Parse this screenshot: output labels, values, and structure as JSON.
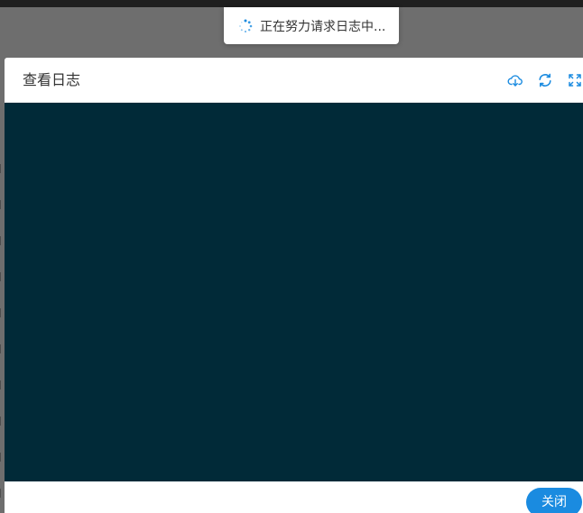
{
  "toast": {
    "spinner_icon": "loading-spinner-icon",
    "message": "正在努力请求日志中..."
  },
  "modal": {
    "title": "查看日志",
    "header_icons": [
      "cloud-download-icon",
      "refresh-icon",
      "fullscreen-icon"
    ],
    "log_content": "",
    "log_background": "#012a38",
    "accent_color": "#1a8be0",
    "footer": {
      "close_label": "关闭"
    }
  }
}
